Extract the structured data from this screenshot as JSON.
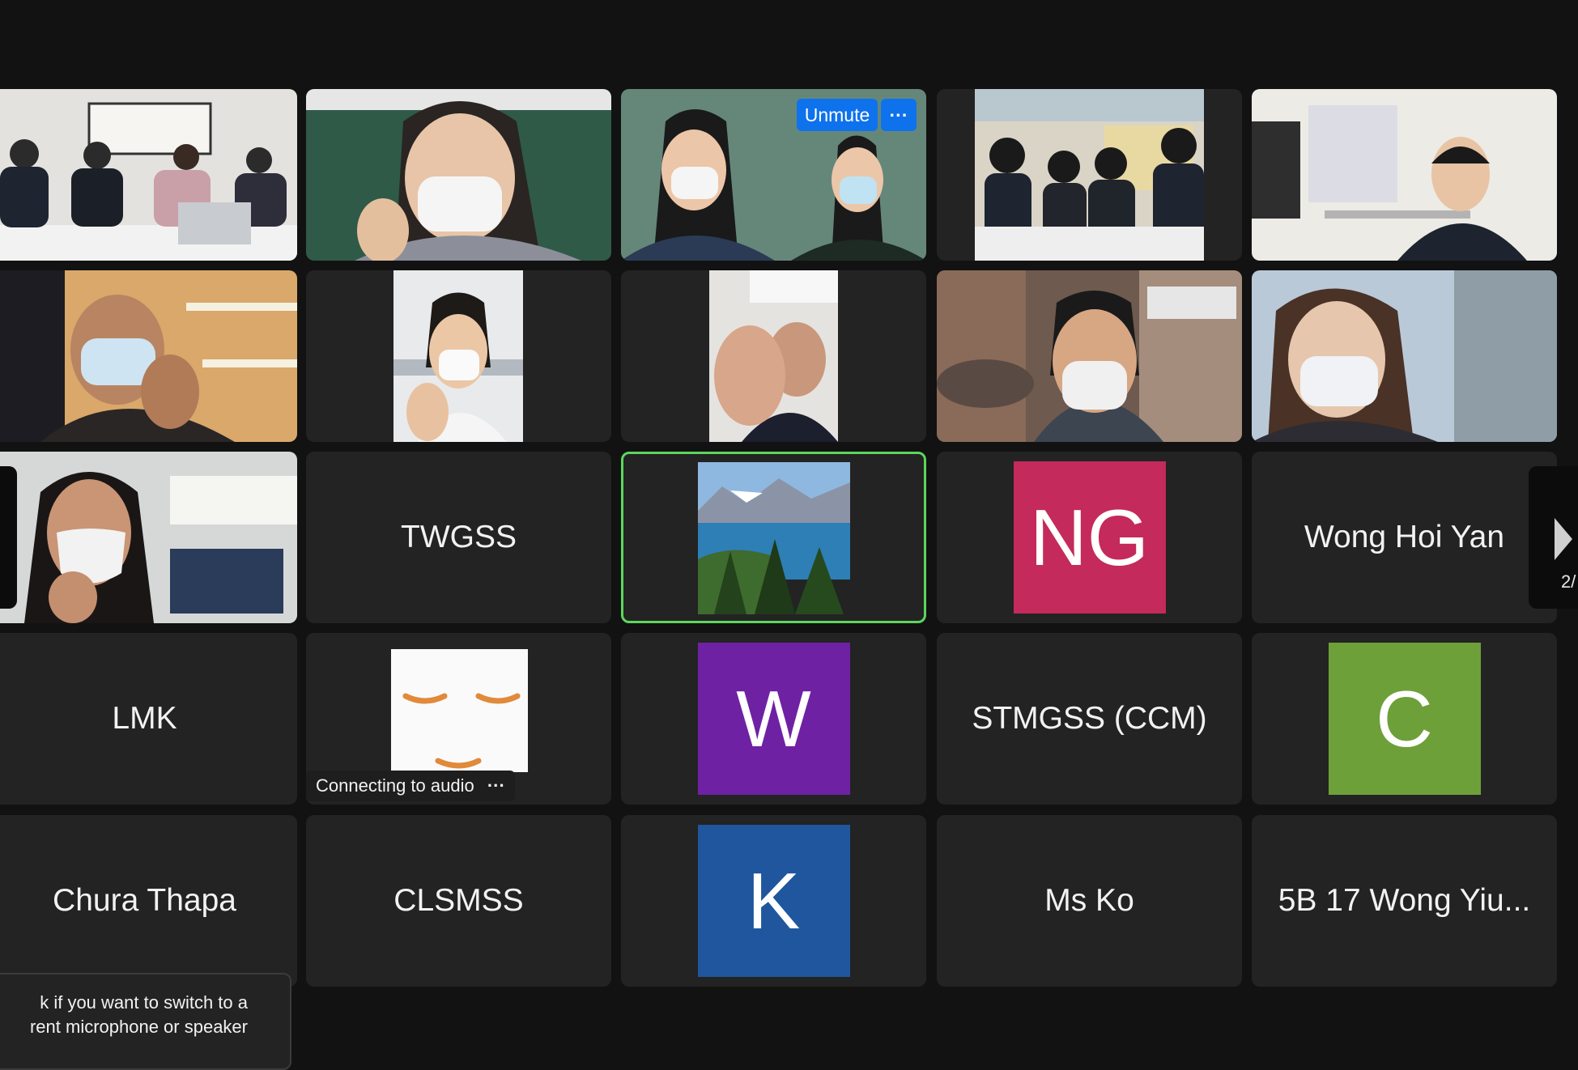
{
  "tiles": {
    "twgss": {
      "name": "TWGSS"
    },
    "wong_hoi_yan": {
      "name": "Wong Hoi Yan"
    },
    "lmk": {
      "name": "LMK"
    },
    "stmgss": {
      "name": "STMGSS (CCM)"
    },
    "chura_thapa": {
      "name": "Chura Thapa"
    },
    "clsmss": {
      "name": "CLSMSS"
    },
    "ms_ko": {
      "name": "Ms Ko"
    },
    "wong_yiu": {
      "name": "5B 17 Wong Yiu..."
    }
  },
  "avatars": {
    "ng": {
      "initials": "NG",
      "color": "#c42a5b"
    },
    "w": {
      "initials": "W",
      "color": "#6f21a3"
    },
    "c": {
      "initials": "C",
      "color": "#6ea03a"
    },
    "k": {
      "initials": "K",
      "color": "#1f569d"
    }
  },
  "controls": {
    "unmute_label": "Unmute",
    "more_label": "···",
    "audio_status": "Connecting to audio",
    "audio_more": "···",
    "page_indicator": "2/"
  },
  "tooltip": {
    "line1": "k if you want to switch to a",
    "line2": "rent microphone or speaker"
  }
}
